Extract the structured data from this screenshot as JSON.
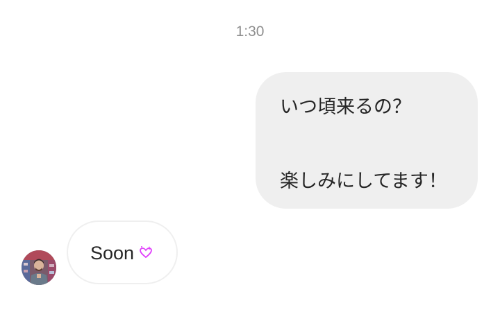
{
  "thread": {
    "timestamp": "1:30"
  },
  "messages": {
    "sent": {
      "line1": "いつ頃来るの？",
      "line2": "楽しみにしてます！"
    },
    "received": {
      "text": "Soon",
      "emoji_icon": "sparkling-heart-emoji-icon",
      "avatar_icon": "contact-avatar"
    }
  },
  "colors": {
    "sent_bubble": "#efefef",
    "received_border": "#efefef",
    "text": "#262626",
    "timestamp": "#8e8e8e",
    "emoji": "#e040fb"
  }
}
